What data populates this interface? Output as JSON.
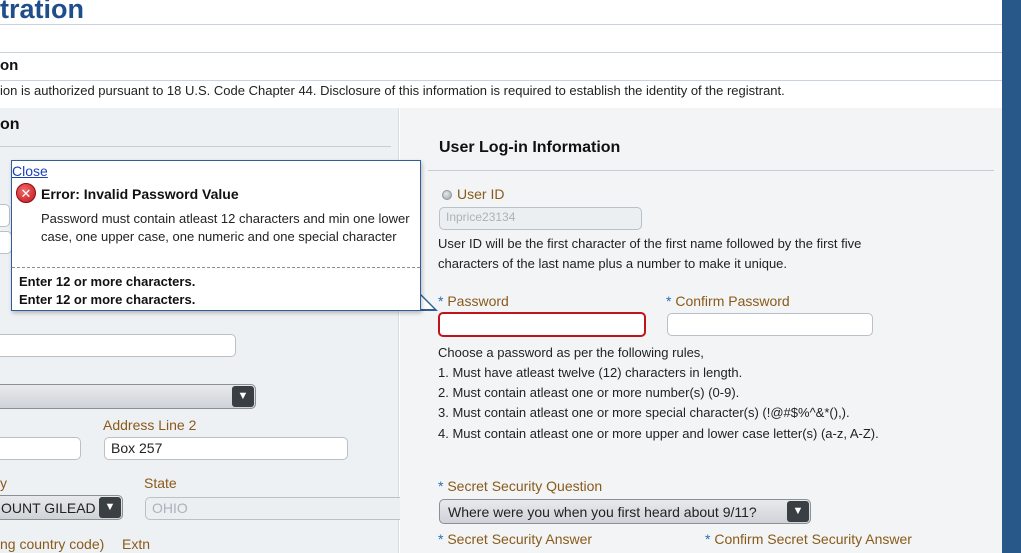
{
  "page": {
    "title": "tration",
    "section_heading": "on",
    "notice": "ion is authorized pursuant to 18 U.S. Code Chapter 44. Disclosure of this information is required to establish the identity of the registrant."
  },
  "left_panel": {
    "heading": "on",
    "address_line2_label": "Address Line 2",
    "address_line2_value": "Box 257",
    "city_label": "y",
    "city_value": "OUNT GILEAD",
    "state_label": "State",
    "state_value": "OHIO",
    "phone_label": "ng country code)",
    "extn_label": "Extn"
  },
  "error_popup": {
    "close_label": "Close",
    "title": "Error: Invalid Password Value",
    "description": "Password must contain atleast 12 characters and min one lower case, one upper case, one numeric and one special character",
    "messages": [
      "Enter 12 or more characters.",
      "Enter 12 or more characters."
    ]
  },
  "right_panel": {
    "heading": "User Log-in Information",
    "user_id_label": "User ID",
    "user_id_value": "Inprice23134",
    "user_id_help_1": "User ID will be the first character of the first name followed by the first five",
    "user_id_help_2": "characters of the last name plus a number to make it unique.",
    "required_marker": "*",
    "password_label": "Password",
    "confirm_password_label": "Confirm Password",
    "password_value": "",
    "confirm_password_value": "",
    "rules_intro": "Choose a password as per the following rules,",
    "rules": [
      "1. Must have atleast twelve (12) characters in length.",
      "2. Must contain atleast one or more number(s) (0-9).",
      "3. Must contain atleast one or more special character(s) (!@#$%^&*(),).",
      "4. Must contain atleast one or more upper and lower case letter(s) (a-z, A-Z)."
    ],
    "secret_question_label": "Secret Security Question",
    "secret_question_value": "Where were you when you first heard about 9/11?",
    "secret_answer_label": "Secret Security Answer",
    "confirm_secret_answer_label": "Confirm Secret Security Answer"
  },
  "icons": {
    "select_arrow": "chevron-down-icon",
    "error": "error-circle-icon",
    "radio": "radio-icon"
  },
  "colors": {
    "title_blue": "#1f4e8c",
    "error_red": "#c0141b",
    "label_brown": "#8a5a1a",
    "required_blue": "#2a6fb5",
    "link_blue": "#1b3fb5"
  }
}
